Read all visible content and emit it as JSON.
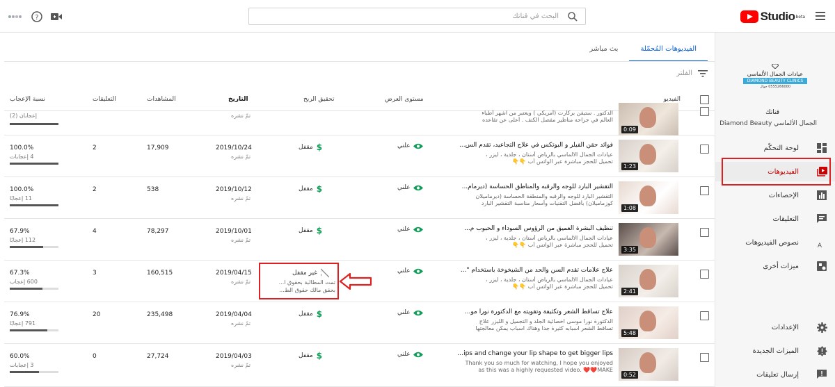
{
  "app": {
    "logo_text": "Studio",
    "beta": "beta",
    "search_placeholder": "البحث في قناتك"
  },
  "sidebar": {
    "logo_line1": "عيادات الجمال الألماسي",
    "logo_line2": "DIAMOND BEAUTY CLINICS",
    "logo_line3": "0555266000 جوال",
    "channel_label": "قناتك",
    "channel_name": "الجمال الألماسي Diamond Beauty",
    "items": [
      {
        "label": "لوحة التحكّم",
        "icon": "dashboard-icon"
      },
      {
        "label": "الفيديوهات",
        "icon": "videos-icon"
      },
      {
        "label": "الإحصاءات",
        "icon": "analytics-icon"
      },
      {
        "label": "التعليقات",
        "icon": "comments-icon"
      },
      {
        "label": "نصوص الفيديوهات",
        "icon": "translate-icon"
      },
      {
        "label": "ميزات أخرى",
        "icon": "other-features-icon"
      },
      {
        "label": "الإعدادات",
        "icon": "gear-icon"
      },
      {
        "label": "الميزات الجديدة",
        "icon": "whats-new-icon"
      },
      {
        "label": "إرسال تعليقات",
        "icon": "feedback-icon"
      }
    ]
  },
  "tabs": [
    {
      "label": "الفيديوهات المُحمّلة"
    },
    {
      "label": "بث مباشر"
    }
  ],
  "filter_placeholder": "الفلتر",
  "columns": {
    "video": "الفيديو",
    "visibility": "مستوى العرض",
    "monetization": "تحقيق الربح",
    "date": "التاريخ",
    "views": "المشاهدات",
    "comments": "التعليقات",
    "likes": "نسبة الإعجاب"
  },
  "rows": [
    {
      "duration": "0:09",
      "title": "",
      "desc1": "الدكتور . ستيفن بركارت (أمريكي ) ويعتبر من اشهر أطباء",
      "desc2": "العالم في جراحه مناظير مفصل الكتف . أعلى عن تقاعده",
      "visibility": "",
      "monetization": "",
      "date": "",
      "date_status": "تمّ نشره",
      "views": "",
      "comments": "",
      "pct": "",
      "likes": "إعجابان (2)",
      "like_frac": 1.0
    },
    {
      "duration": "1:23",
      "title": "فوائد حقن الفيلر و البوتكس في علاج التجاعيد، تقدم الس...",
      "desc1": "عيادات الجمال الالماسي بالرياض أستان ، جلدية ، ليزر ،",
      "desc2": "تحميل للحجز مباشرة عبر الواتس أب 👇👇",
      "visibility": "علني",
      "monetization": "مقفل",
      "date": "2019/10/24",
      "date_status": "تمّ نشره",
      "views": "17,909",
      "comments": "2",
      "pct": "100.0%",
      "likes": "4 إعجابات",
      "like_frac": 1.0
    },
    {
      "duration": "1:08",
      "title": "التقشير البارد للوجه والرقبه والمناطق الحساسة (ديرمام...",
      "desc1": "التقشير البارد للوجه والرقبه والمنطقة الحساسة (ديرماميلان",
      "desc2": "كوزماميلان) بأفضل التقنيات وأسعار مناسبة التقشير البارد",
      "visibility": "علني",
      "monetization": "مقفل",
      "date": "2019/10/12",
      "date_status": "تمّ نشره",
      "views": "538",
      "comments": "2",
      "pct": "100.0%",
      "likes": "11 إعجابًا",
      "like_frac": 1.0
    },
    {
      "duration": "3:35",
      "title": "تنظيف البشرة العميق من الرؤوس السوداء و الحبوب م...",
      "desc1": "عيادات الجمال الالماسي بالرياض أستان ، جلدية ، ليزر ،",
      "desc2": "تحميل للحجز مباشرة عبر الواتس أب 👇👇",
      "visibility": "علني",
      "monetization": "مقفل",
      "date": "2019/10/01",
      "date_status": "تمّ نشره",
      "views": "78,297",
      "comments": "4",
      "pct": "67.9%",
      "likes": "112 إعجابًا",
      "like_frac": 0.679
    },
    {
      "duration": "2:41",
      "title": "علاج علامات تقدم السن والحد من الشيخوخة باستخدام \"...",
      "desc1": "عيادات الجمال الالماسي بالرياض أستان ، جلدية ، ليزر ،",
      "desc2": "تحميل للحجز مباشرة عبر الواتس أب 👇👇",
      "visibility": "علني",
      "monetization": "غير مقفل",
      "mon_desc1": "تمت المطالبة بحقوق ا...",
      "mon_desc2": "بحقق مالك حقوق الط...",
      "date": "2019/04/15",
      "date_status": "تمّ نشره",
      "views": "160,515",
      "comments": "3",
      "pct": "67.3%",
      "likes": "600 إعجاب",
      "like_frac": 0.673
    },
    {
      "duration": "5:48",
      "title": "علاج تساقط الشعر وتكثيفة وتقويته مع الدكتورة نورا مو...",
      "desc1": "الدكتورة نورا موسى اخصائية الجلد و التجميل و الليزر علاج",
      "desc2": "تساقط الشعر اسبابه كثيرة جداً وهناك اسباب يمكن معالجتها",
      "visibility": "علني",
      "monetization": "مقفل",
      "date": "2019/04/04",
      "date_status": "تمّ نشره",
      "views": "235,498",
      "comments": "20",
      "pct": "76.9%",
      "likes": "791 إعجابًا",
      "like_frac": 0.769
    },
    {
      "duration": "0:52",
      "title": "Lips and change your lip shape to get bigger lips ...",
      "desc1": "Thank you so much for watching, I hope you enjoyed",
      "desc2": "as this was a highly requested video. ❤️❤️MAKE",
      "visibility": "علني",
      "monetization": "مقفل",
      "date": "2019/04/03",
      "date_status": "تمّ نشره",
      "views": "27,724",
      "comments": "0",
      "pct": "60.0%",
      "likes": "3 إعجابات",
      "like_frac": 0.6
    }
  ],
  "colors": {
    "accent": "#065fd4",
    "youtube_red": "#ff0000",
    "highlight": "#e02020",
    "money_green": "#0f9d58",
    "eye_green": "#0f9d58"
  }
}
